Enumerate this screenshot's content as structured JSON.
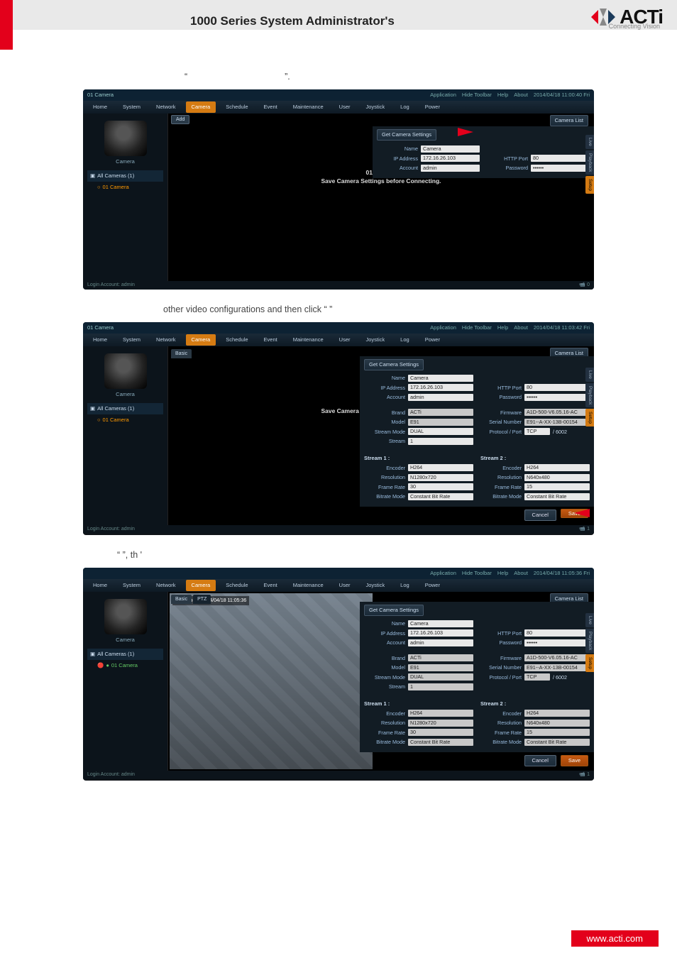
{
  "header": {
    "doc_title": "1000 Series System Administrator's",
    "logo_text": "ACTi",
    "logo_tagline": "Connecting Vision"
  },
  "body_text": {
    "line1_quote_open": "“",
    "line1_quote_close": "”.",
    "line2": "other video configurations and then click “        ”",
    "line3": "“       ”, th            '"
  },
  "nvr_common": {
    "window_title": "01 Camera",
    "top_links": {
      "application": "Application",
      "hide_toolbar": "Hide Toolbar",
      "help": "Help",
      "about": "About"
    },
    "menu": {
      "home": "Home",
      "system": "System",
      "network": "Network",
      "camera": "Camera",
      "schedule": "Schedule",
      "event": "Event",
      "maintenance": "Maintenance",
      "user": "User",
      "joystick": "Joystick",
      "log": "Log",
      "power": "Power"
    },
    "side": {
      "camera_caption": "Camera",
      "tree_header": "All Cameras (1)",
      "tree_item": "01  Camera"
    },
    "view_msg_title": "01 Camera",
    "view_msg_sub": "Save Camera Settings before Connecting.",
    "settings": {
      "get_camera_settings": "Get Camera Settings",
      "camera_list": "Camera List",
      "name_label": "Name",
      "name_value": "Camera",
      "ip_label": "IP Address",
      "ip_value": "172.16.26.103",
      "account_label": "Account",
      "account_value": "admin",
      "http_port_label": "HTTP Port",
      "http_port_value": "80",
      "password_label": "Password",
      "password_value": "••••••"
    },
    "side_tabs": {
      "live": "Live",
      "playback": "Playback",
      "setup": "Setup"
    },
    "footer_left": "Login Account: admin",
    "add_label": "Add",
    "basic_tab": "Basic",
    "ptz_tab": "PTZ",
    "buttons": {
      "cancel": "Cancel",
      "save": "Save"
    },
    "ext": {
      "brand_label": "Brand",
      "brand_value": "ACTi",
      "model_label": "Model",
      "model_value": "E91",
      "stream_mode_label": "Stream Mode",
      "stream_mode_value": "DUAL",
      "stream_label": "Stream",
      "stream_value": "1",
      "firmware_label": "Firmware",
      "firmware_value": "A1D-500-V6.05.16-AC",
      "serial_label": "Serial Number",
      "serial_value": "E91--A-XX-13B-00154",
      "protocol_label": "Protocol / Port",
      "protocol_value": "TCP",
      "protocol_port": "/ 6002",
      "s1_label": "Stream 1 :",
      "s2_label": "Stream 2 :",
      "encoder_label": "Encoder",
      "encoder_value": "H264",
      "res_label": "Resolution",
      "res1_value": "N1280x720",
      "res2_value": "N640x480",
      "fr_label": "Frame Rate",
      "fr1_value": "30",
      "fr2_value": "15",
      "br_label": "Bitrate Mode",
      "br_value": "Constant Bit Rate"
    }
  },
  "timestamps": {
    "shot1": "2014/04/18 11:00:40 Fri",
    "shot2": "2014/04/18 11:03:42 Fri",
    "shot3": "2014/04/18 11:05:36 Fri",
    "live_overlay": "01 Camera  2014/04/18 11:05:36"
  },
  "footer_counts": {
    "shot1": "0",
    "shot2": "1",
    "shot3": "1"
  },
  "footer_url": "www.acti.com"
}
